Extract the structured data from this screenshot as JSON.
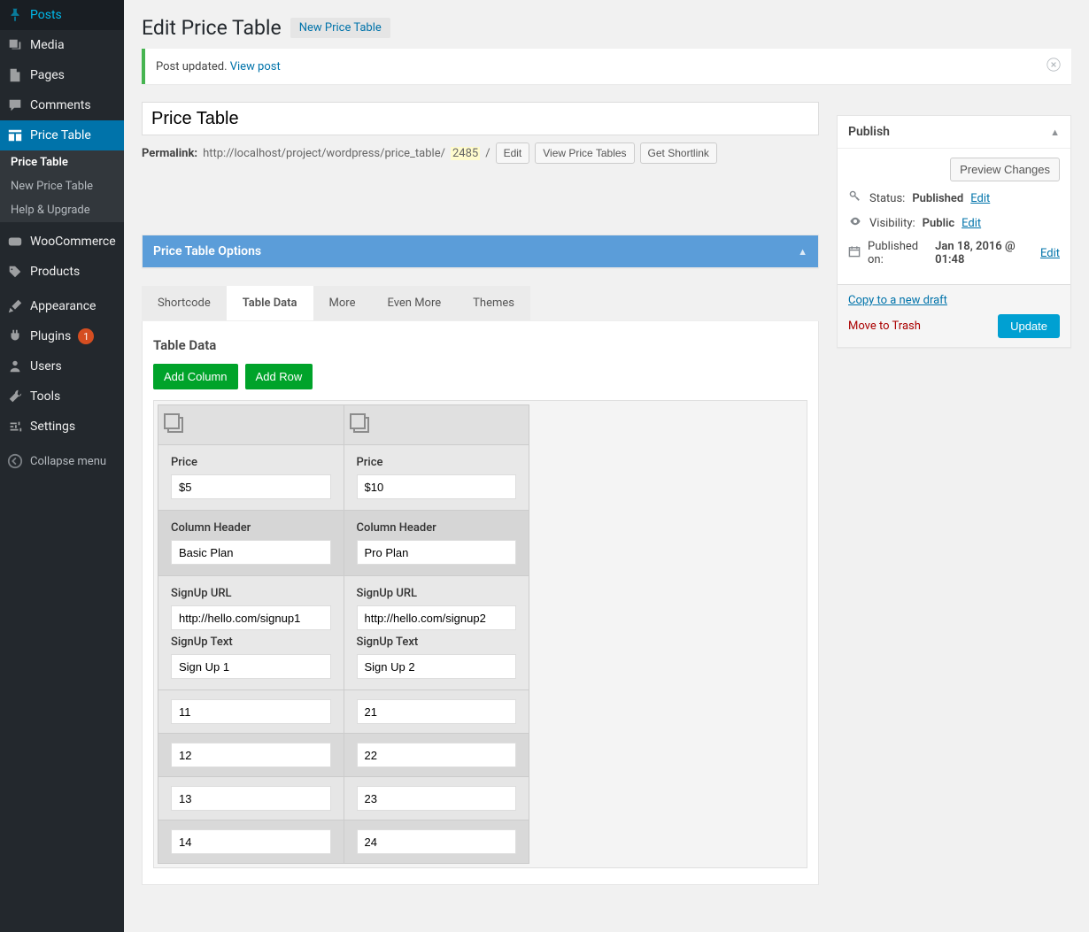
{
  "sidebar": {
    "posts": "Posts",
    "media": "Media",
    "pages": "Pages",
    "comments": "Comments",
    "price_table": "Price Table",
    "sub": {
      "price_table": "Price Table",
      "new_price_table": "New Price Table",
      "help_upgrade": "Help & Upgrade"
    },
    "woocommerce": "WooCommerce",
    "products": "Products",
    "appearance": "Appearance",
    "plugins": "Plugins",
    "plugins_badge": "1",
    "users": "Users",
    "tools": "Tools",
    "settings": "Settings",
    "collapse": "Collapse menu"
  },
  "heading": {
    "title": "Edit Price Table",
    "add_new": "New Price Table"
  },
  "notice": {
    "text": "Post updated. ",
    "link": "View post"
  },
  "post": {
    "title": "Price Table",
    "permalink_label": "Permalink:",
    "permalink_base": "http://localhost/project/wordpress/price_table/",
    "permalink_slug": "2485",
    "permalink_tail": "/",
    "btn_edit": "Edit",
    "btn_view": "View Price Tables",
    "btn_shortlink": "Get Shortlink"
  },
  "options_panel": {
    "title": "Price Table Options"
  },
  "tabs": {
    "shortcode": "Shortcode",
    "table_data": "Table Data",
    "more": "More",
    "even_more": "Even More",
    "themes": "Themes"
  },
  "table_data": {
    "heading": "Table Data",
    "add_column": "Add Column",
    "add_row": "Add Row",
    "labels": {
      "price": "Price",
      "column_header": "Column Header",
      "signup_url": "SignUp URL",
      "signup_text": "SignUp Text"
    },
    "columns": [
      {
        "price": "$5",
        "header": "Basic Plan",
        "signup_url": "http://hello.com/signup1",
        "signup_text": "Sign Up 1",
        "rows": [
          "11",
          "12",
          "13",
          "14"
        ]
      },
      {
        "price": "$10",
        "header": "Pro Plan",
        "signup_url": "http://hello.com/signup2",
        "signup_text": "Sign Up 2",
        "rows": [
          "21",
          "22",
          "23",
          "24"
        ]
      }
    ]
  },
  "publish": {
    "title": "Publish",
    "preview": "Preview Changes",
    "status_label": "Status: ",
    "status_value": "Published",
    "status_edit": "Edit",
    "visibility_label": "Visibility: ",
    "visibility_value": "Public",
    "visibility_edit": "Edit",
    "published_label": "Published on: ",
    "published_value": "Jan 18, 2016 @ 01:48",
    "published_edit": "Edit",
    "copy_draft": "Copy to a new draft",
    "trash": "Move to Trash",
    "update": "Update"
  }
}
